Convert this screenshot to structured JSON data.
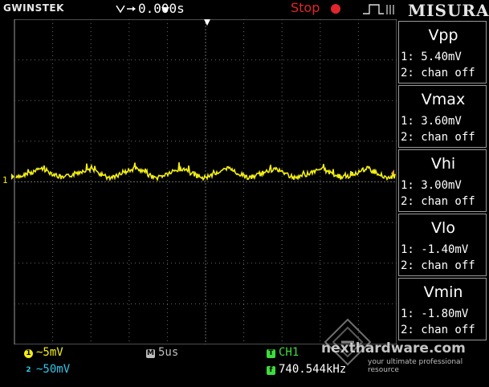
{
  "top_bar": {
    "brand": "GWINSTEK",
    "trigger_position": "0.000s",
    "run_state": "Stop",
    "watermark_title": "MISURA",
    "colors": {
      "run_state": "#e0262c"
    }
  },
  "waveform": {
    "channel_marker": "1",
    "trace_color": "#f2ee13",
    "grid_color": "#6a6a6a",
    "description_values": {
      "channel": "CH1",
      "vpp_mV": 5.4
    }
  },
  "measurements": [
    {
      "title": "Vpp",
      "ch1": "1: 5.40mV",
      "ch2": "2: chan off"
    },
    {
      "title": "Vmax",
      "ch1": "1: 3.60mV",
      "ch2": "2: chan off"
    },
    {
      "title": "Vhi",
      "ch1": "1: 3.00mV",
      "ch2": "2: chan off"
    },
    {
      "title": "Vlo",
      "ch1": "1: -1.40mV",
      "ch2": "2: chan off"
    },
    {
      "title": "Vmin",
      "ch1": "1: -1.80mV",
      "ch2": "2: chan off"
    }
  ],
  "bottom_bar": {
    "ch1_badge": "1",
    "ch1_scale": "~5mV",
    "ch2_badge": "2",
    "ch2_scale": "~50mV",
    "timebase_badge": "M",
    "timebase": "5us",
    "trigger_badge": "T",
    "trigger_source": "CH1",
    "freq_badge": "f",
    "frequency": "740.544kHz",
    "colors": {
      "ch1": "#f2ee13",
      "ch2": "#2fc6e6",
      "timebase": "#bdbdbd",
      "trigger": "#3ddc3d"
    }
  },
  "watermark": {
    "site": "nexthardware.com",
    "tagline": "your ultimate professional resource"
  }
}
